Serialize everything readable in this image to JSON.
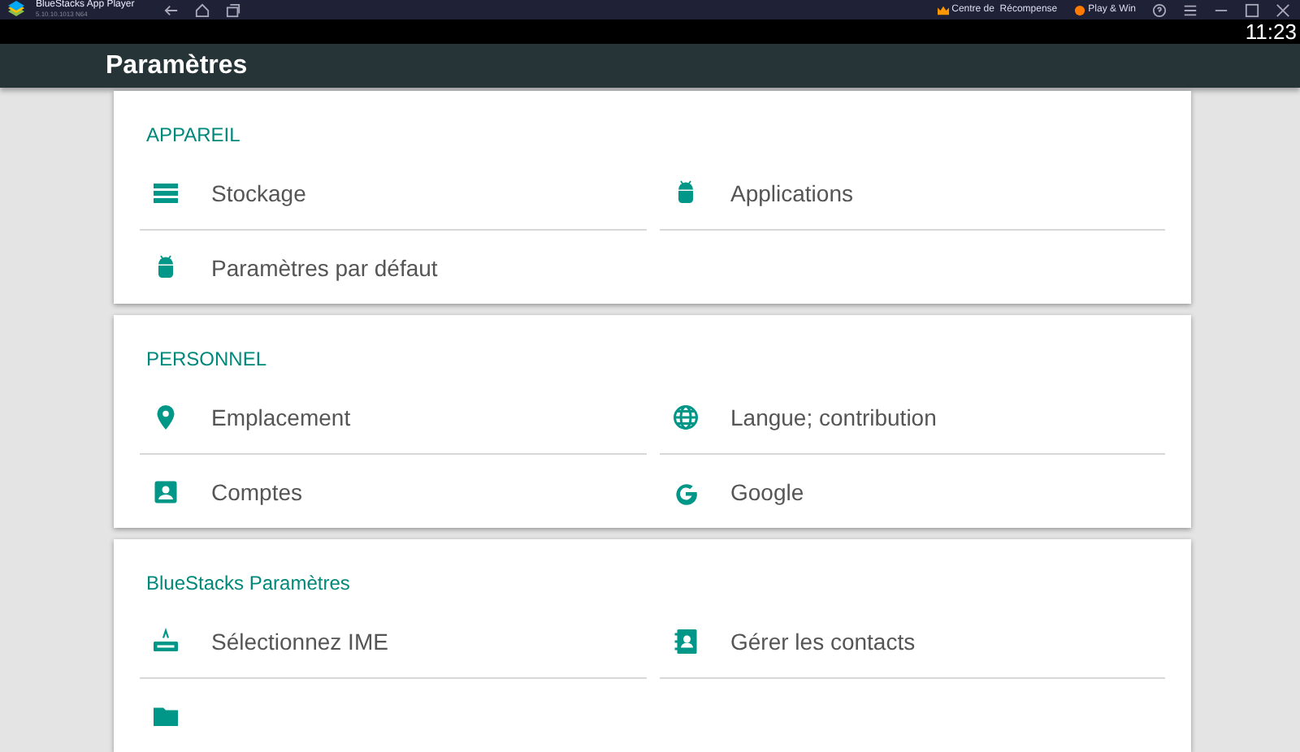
{
  "titlebar": {
    "app_name": "BlueStacks App Player",
    "version": "5.10.10.1013 N64",
    "reward_label": "Centre de  Récompense",
    "play_win_label": "Play & Win"
  },
  "status_bar": {
    "time": "11:23"
  },
  "app_bar": {
    "title": "Paramètres"
  },
  "sections": [
    {
      "title": "APPAREIL",
      "items": [
        {
          "kind": "storage",
          "label": "Stockage"
        },
        {
          "kind": "android",
          "label": "Applications"
        },
        {
          "kind": "android",
          "label": "Paramètres par défaut"
        }
      ]
    },
    {
      "title": "PERSONNEL",
      "items": [
        {
          "kind": "location",
          "label": "Emplacement"
        },
        {
          "kind": "globe",
          "label": "Langue; contribution"
        },
        {
          "kind": "account",
          "label": "Comptes"
        },
        {
          "kind": "google",
          "label": "Google"
        }
      ]
    },
    {
      "title": "BlueStacks Paramètres",
      "items": [
        {
          "kind": "keyboard",
          "label": "Sélectionnez IME"
        },
        {
          "kind": "contacts",
          "label": "Gérer les contacts"
        },
        {
          "kind": "folder"
        }
      ]
    }
  ]
}
